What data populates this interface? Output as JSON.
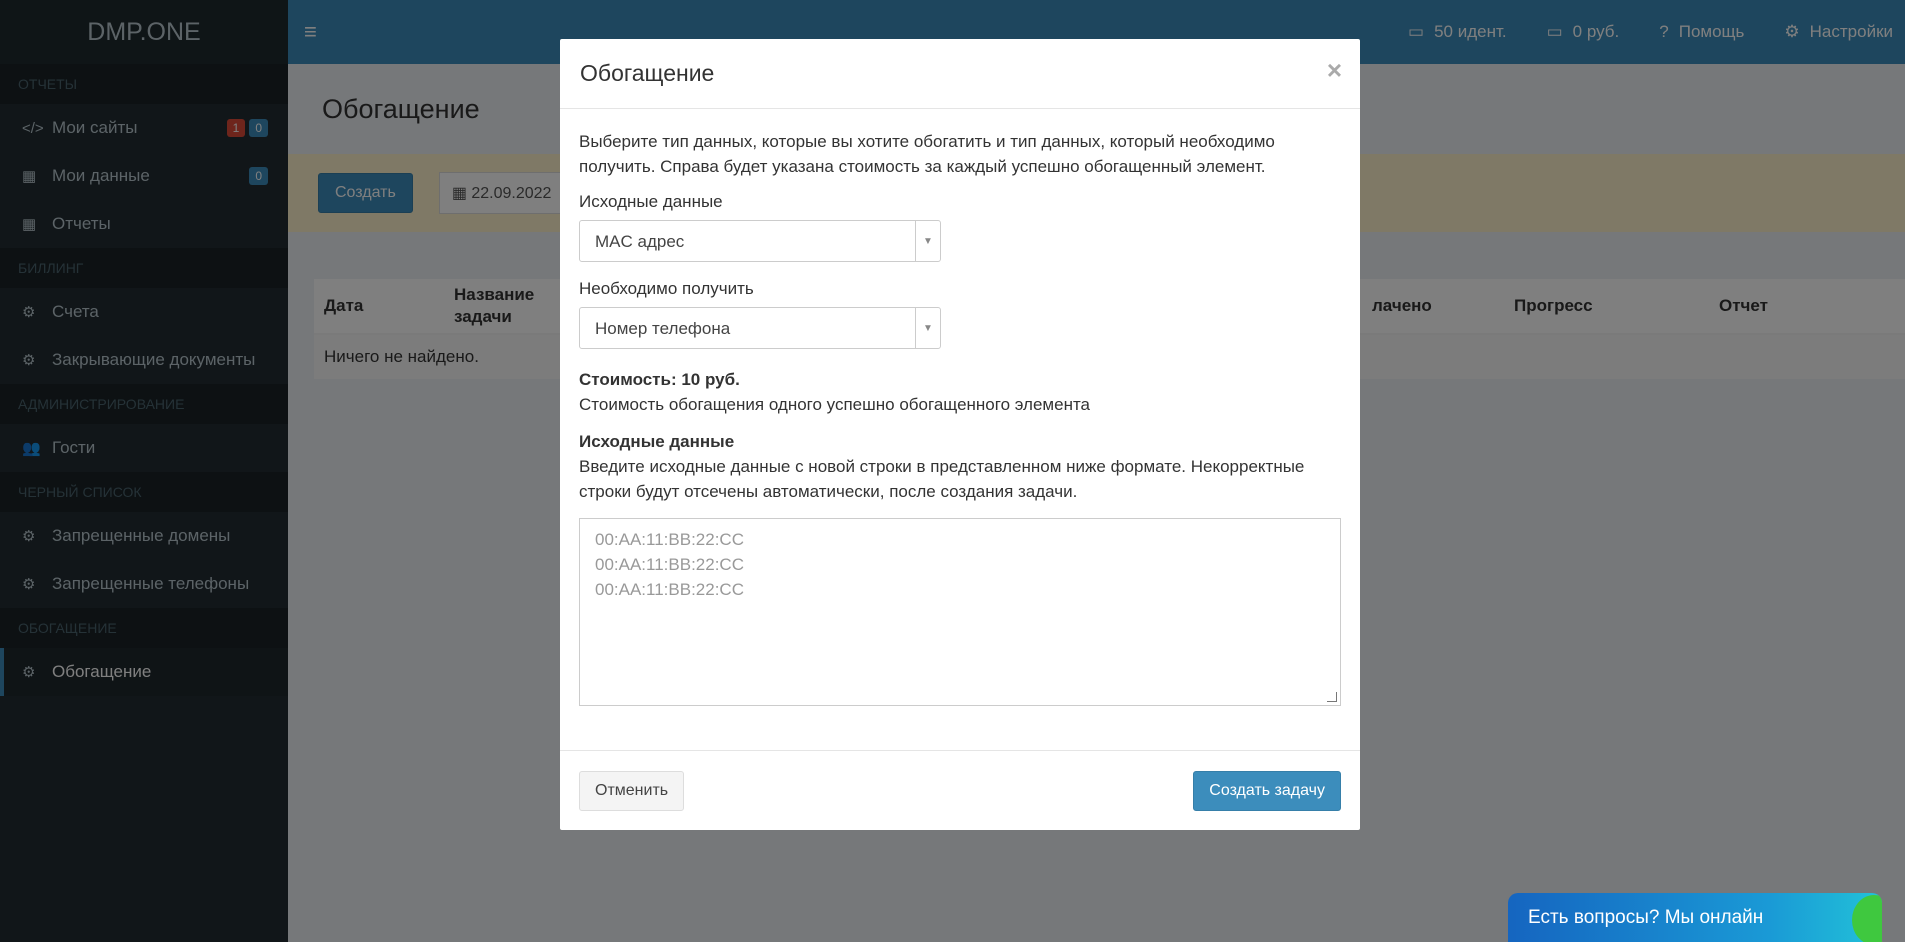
{
  "app": {
    "logo": "DMP.ONE"
  },
  "topbar": {
    "identities": "50 идент.",
    "balance": "0 руб.",
    "help": "Помощь",
    "settings": "Настройки"
  },
  "sidebar": {
    "sections": [
      {
        "header": "ОТЧЕТЫ",
        "items": [
          {
            "label": "Мои сайты",
            "icon": "code-icon",
            "badges": [
              "1",
              "0"
            ]
          },
          {
            "label": "Мои данные",
            "icon": "table-icon",
            "badges": [
              "0"
            ]
          },
          {
            "label": "Отчеты",
            "icon": "table-icon"
          }
        ]
      },
      {
        "header": "БИЛЛИНГ",
        "items": [
          {
            "label": "Счета",
            "icon": "gear-icon"
          },
          {
            "label": "Закрывающие документы",
            "icon": "gear-icon"
          }
        ]
      },
      {
        "header": "АДМИНИСТРИРОВАНИЕ",
        "items": [
          {
            "label": "Гости",
            "icon": "users-icon"
          }
        ]
      },
      {
        "header": "ЧЕРНЫЙ СПИСОК",
        "items": [
          {
            "label": "Запрещенные домены",
            "icon": "gear-icon"
          },
          {
            "label": "Запрещенные телефоны",
            "icon": "gear-icon"
          }
        ]
      },
      {
        "header": "ОБОГАЩЕНИЕ",
        "items": [
          {
            "label": "Обогащение",
            "icon": "gear-icon",
            "active": true
          }
        ]
      }
    ]
  },
  "page": {
    "title": "Обогащение",
    "create_label": "Создать",
    "date_value": "22.09.2022",
    "table": {
      "columns": [
        "Дата",
        "Название задачи",
        "лачено",
        "Прогресс",
        "Отчет"
      ],
      "empty": "Ничего не найдено."
    }
  },
  "modal": {
    "title": "Обогащение",
    "close": "×",
    "intro": "Выберите тип данных, которые вы хотите обогатить и тип данных, который необходимо получить. Справа будет указана стоимость за каждый успешно обогащенный элемент.",
    "source_label": "Исходные данные",
    "source_value": "MAC адрес",
    "target_label": "Необходимо получить",
    "target_value": "Номер телефона",
    "cost_title": "Стоимость: 10 руб.",
    "cost_desc": "Стоимость обогащения одного успешно обогащенного элемента",
    "input_title": "Исходные данные",
    "input_desc": "Введите исходные данные с новой строки в представленном ниже формате. Некорректные строки будут отсечены автоматически, после создания задачи.",
    "placeholder_lines": [
      "00:AA:11:BB:22:CC",
      "00:AA:11:BB:22:CC",
      "00:AA:11:BB:22:CC"
    ],
    "cancel_label": "Отменить",
    "submit_label": "Создать задачу"
  },
  "chat": {
    "label": "Есть вопросы? Мы онлайн"
  }
}
